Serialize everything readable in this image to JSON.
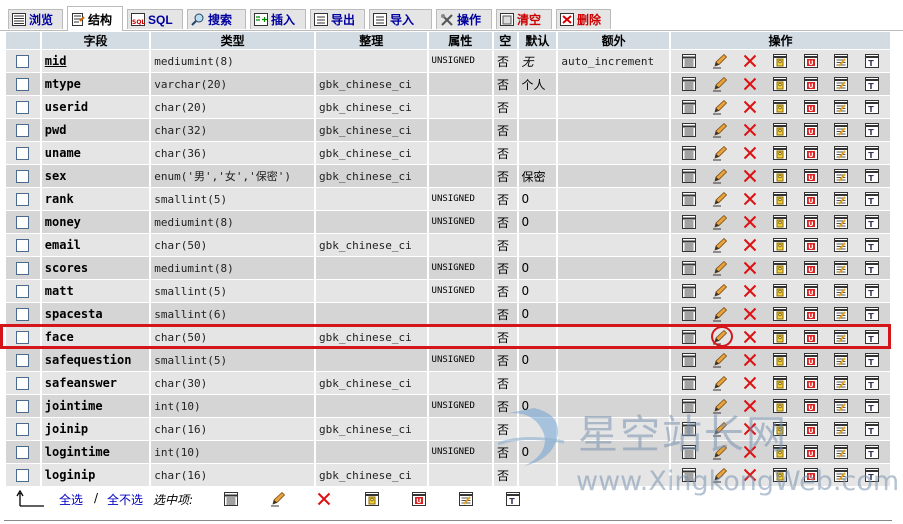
{
  "tabs": [
    {
      "label": "浏览",
      "icon": "browse-icon",
      "state": "normal"
    },
    {
      "label": "结构",
      "icon": "structure-icon",
      "state": "active"
    },
    {
      "label": "SQL",
      "icon": "sql-icon",
      "state": "normal"
    },
    {
      "label": "搜索",
      "icon": "search-icon",
      "state": "normal"
    },
    {
      "label": "插入",
      "icon": "insert-icon",
      "state": "normal"
    },
    {
      "label": "导出",
      "icon": "export-icon",
      "state": "normal"
    },
    {
      "label": "导入",
      "icon": "import-icon",
      "state": "normal"
    },
    {
      "label": "操作",
      "icon": "operations-icon",
      "state": "normal"
    },
    {
      "label": "清空",
      "icon": "empty-icon",
      "state": "warn"
    },
    {
      "label": "删除",
      "icon": "drop-icon",
      "state": "warn"
    }
  ],
  "table": {
    "headers": {
      "field": "字段",
      "type": "类型",
      "collation": "整理",
      "attributes": "属性",
      "null": "空",
      "default": "默认",
      "extra": "额外",
      "action": "操作"
    },
    "rows": [
      {
        "field": "mid",
        "type": "mediumint(8)",
        "collation": "",
        "attributes": "UNSIGNED",
        "null": "否",
        "default": "无",
        "extra": "auto_increment",
        "primary": true
      },
      {
        "field": "mtype",
        "type": "varchar(20)",
        "collation": "gbk_chinese_ci",
        "attributes": "",
        "null": "否",
        "default": "个人",
        "extra": ""
      },
      {
        "field": "userid",
        "type": "char(20)",
        "collation": "gbk_chinese_ci",
        "attributes": "",
        "null": "否",
        "default": "",
        "extra": ""
      },
      {
        "field": "pwd",
        "type": "char(32)",
        "collation": "gbk_chinese_ci",
        "attributes": "",
        "null": "否",
        "default": "",
        "extra": ""
      },
      {
        "field": "uname",
        "type": "char(36)",
        "collation": "gbk_chinese_ci",
        "attributes": "",
        "null": "否",
        "default": "",
        "extra": ""
      },
      {
        "field": "sex",
        "type": "enum('男','女','保密')",
        "collation": "gbk_chinese_ci",
        "attributes": "",
        "null": "否",
        "default": "保密",
        "extra": ""
      },
      {
        "field": "rank",
        "type": "smallint(5)",
        "collation": "",
        "attributes": "UNSIGNED",
        "null": "否",
        "default": "0",
        "extra": ""
      },
      {
        "field": "money",
        "type": "mediumint(8)",
        "collation": "",
        "attributes": "UNSIGNED",
        "null": "否",
        "default": "0",
        "extra": ""
      },
      {
        "field": "email",
        "type": "char(50)",
        "collation": "gbk_chinese_ci",
        "attributes": "",
        "null": "否",
        "default": "",
        "extra": ""
      },
      {
        "field": "scores",
        "type": "mediumint(8)",
        "collation": "",
        "attributes": "UNSIGNED",
        "null": "否",
        "default": "0",
        "extra": ""
      },
      {
        "field": "matt",
        "type": "smallint(5)",
        "collation": "",
        "attributes": "UNSIGNED",
        "null": "否",
        "default": "0",
        "extra": ""
      },
      {
        "field": "spacesta",
        "type": "smallint(6)",
        "collation": "",
        "attributes": "",
        "null": "否",
        "default": "0",
        "extra": ""
      },
      {
        "field": "face",
        "type": "char(50)",
        "collation": "gbk_chinese_ci",
        "attributes": "",
        "null": "否",
        "default": "",
        "extra": "",
        "highlighted": true
      },
      {
        "field": "safequestion",
        "type": "smallint(5)",
        "collation": "",
        "attributes": "UNSIGNED",
        "null": "否",
        "default": "0",
        "extra": ""
      },
      {
        "field": "safeanswer",
        "type": "char(30)",
        "collation": "gbk_chinese_ci",
        "attributes": "",
        "null": "否",
        "default": "",
        "extra": ""
      },
      {
        "field": "jointime",
        "type": "int(10)",
        "collation": "",
        "attributes": "UNSIGNED",
        "null": "否",
        "default": "0",
        "extra": ""
      },
      {
        "field": "joinip",
        "type": "char(16)",
        "collation": "gbk_chinese_ci",
        "attributes": "",
        "null": "否",
        "default": "",
        "extra": ""
      },
      {
        "field": "logintime",
        "type": "int(10)",
        "collation": "",
        "attributes": "UNSIGNED",
        "null": "否",
        "default": "0",
        "extra": ""
      },
      {
        "field": "loginip",
        "type": "char(16)",
        "collation": "gbk_chinese_ci",
        "attributes": "",
        "null": "否",
        "default": "",
        "extra": ""
      }
    ],
    "row_actions": [
      "browse-distinct-icon",
      "edit-pencil-icon",
      "delete-x-icon",
      "primary-key-icon",
      "unique-icon",
      "index-icon",
      "fulltext-icon"
    ]
  },
  "bottom": {
    "check_all": "全选",
    "separator": "/",
    "uncheck_all": "全不选",
    "with_selected": "选中项:"
  },
  "watermark": {
    "cn": "星空站长网",
    "en": "www.XingkongWeb.com"
  },
  "colors": {
    "header_bg": "#d3dce3",
    "row_odd": "#e5e5e5",
    "row_even": "#d5d5d5",
    "highlight": "#d4161b",
    "link": "#0000c0"
  }
}
